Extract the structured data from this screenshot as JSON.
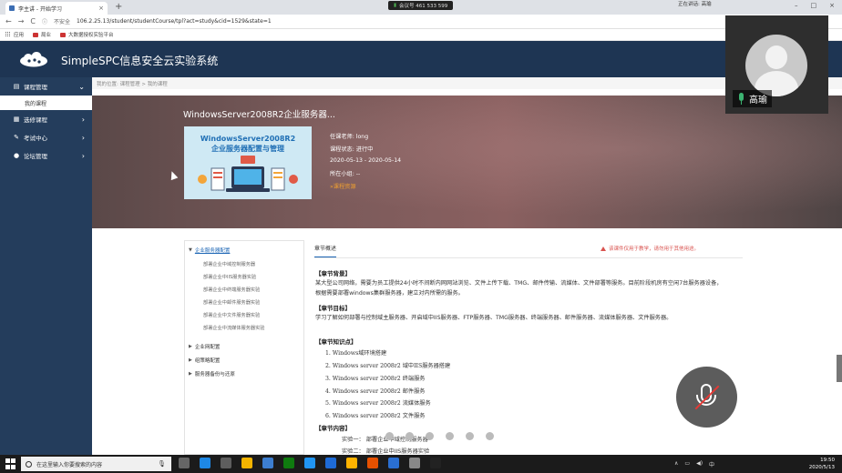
{
  "browser": {
    "tab_title": "李主讲 - 开始学习",
    "tab_close": "×",
    "new_tab": "+",
    "call_text": "会议号 461 533 599",
    "top_right_text": "正在讲话: 高瑜",
    "window_controls": [
      "–",
      "□",
      "×"
    ],
    "nav": {
      "back": "←",
      "forward": "→",
      "reload": "C",
      "home": "⌂"
    },
    "security_label": "不安全",
    "url": "106.2.25.13/student/studentCourse/tpl?act=study&cid=1529&state=1",
    "bookmarks": [
      "应用",
      "局业",
      "大数据授权实验平台"
    ]
  },
  "app": {
    "title": "SimpleSPC信息安全云实验系统",
    "sidebar": [
      {
        "label": "课程管理",
        "icon": "book-icon",
        "chevron": "⌄"
      },
      {
        "label": "我的课程",
        "sub": true
      },
      {
        "label": "选修课程",
        "icon": "grid-icon",
        "chevron": "›"
      },
      {
        "label": "考试中心",
        "icon": "edit-icon",
        "chevron": "›"
      },
      {
        "label": "论坛管理",
        "icon": "chat-icon",
        "chevron": "›"
      }
    ],
    "breadcrumb": "我的位置:  课程管理 > 我的课程",
    "course": {
      "title": "WindowsServer2008R2企业服务器...",
      "image_line1": "WindowsServer2008R2",
      "image_line2": "企业服务器配置与管理",
      "teacher": "任课老师:  long",
      "status": "课程状态:  进行中",
      "dates": "2020-05-13 - 2020-05-14",
      "group": "所在小组:  --",
      "resources": "»课程资源"
    },
    "outline": {
      "active_chapter": "企业服务器配置",
      "active_subs": [
        "部署企业中域控制服务器",
        "部署企业中IIS服务器实验",
        "部署企业中终端服务器实验",
        "部署企业中邮件服务器实验",
        "部署企业中文件服务器实验",
        "部署企业中流媒体服务器实验"
      ],
      "chapters": [
        "企业网配置",
        "组策略配置",
        "服务器备份与还原"
      ]
    },
    "panel": {
      "tab": "章节概述",
      "warning": "该课件仅用于教学，请勿用于其他用途。",
      "sec_bg_title": "【章节背景】",
      "sec_bg_text": "某大型公司网络，需要为员工提供24小时不间断内网网站浏览、文件上传下载、TMG、邮件传输、流媒体、文件部署等服务。目前阶段机房有空闲7台服务器设备，根据需要部署windows集群服务器，建立对内所需的服务。",
      "sec_goal_title": "【章节目标】",
      "sec_goal_text": "学习了解如何部署与控制域主服务器、开启域中IIS服务器、FTP服务器、TMG服务器、终端服务器、邮件服务器、流媒体服务器、文件服务器。",
      "sec_kp_title": "【章节知识点】",
      "knowledge": [
        "1.  Windows域环境搭建",
        "2.  Windows server 2008r2  域中IIS服务器搭建",
        "3.  Windows server 2008r2  终端服务",
        "4.  Windows server 2008r2  邮件服务",
        "5.  Windows server 2008r2  流媒体服务",
        "6.  Windows server 2008r2  文件服务"
      ],
      "sec_content_title": "【章节内容】",
      "experiments": [
        "实验一：  部署企业中域控制服务器",
        "实验二：  部署企业中IIS服务器实验"
      ]
    }
  },
  "video": {
    "name": "高瑜"
  },
  "taskbar": {
    "search_placeholder": "在这里输入你要搜索的内容",
    "time": "19:50",
    "date": "2020/5/13",
    "icon_colors": [
      "#666",
      "#1e88e5",
      "#5e5e5e",
      "#f4b400",
      "#3d7ecf",
      "#0f7b0f",
      "#2196f3",
      "#1e6bd6",
      "#ffb300",
      "#e65100",
      "#2a6fd1",
      "#888",
      "#222"
    ]
  },
  "colors": {
    "header": "#1e3553",
    "sidebar": "#243d5c",
    "accent": "#1a64b4",
    "warning": "#d9534f",
    "link_orange": "#f0a030"
  }
}
